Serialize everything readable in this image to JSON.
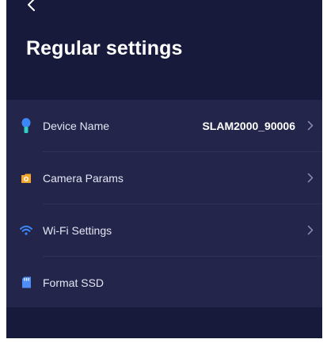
{
  "header": {
    "back_icon": "chevron-left-icon",
    "title": "Regular settings"
  },
  "settings": {
    "items": [
      {
        "icon": "pin-icon",
        "label": "Device Name",
        "value": "SLAM2000_90006",
        "has_chevron": true
      },
      {
        "icon": "folder-camera-icon",
        "label": "Camera Params",
        "value": "",
        "has_chevron": true
      },
      {
        "icon": "wifi-icon",
        "label": "Wi-Fi Settings",
        "value": "",
        "has_chevron": true
      },
      {
        "icon": "sd-card-icon",
        "label": "Format SSD",
        "value": "",
        "has_chevron": false
      }
    ]
  },
  "colors": {
    "background": "#171a3a",
    "list_background": "#23254a",
    "pin_blue": "#3d86f5",
    "pin_teal": "#2ed1c4",
    "folder_orange": "#f2a72a",
    "wifi_blue": "#3d86f5",
    "sd_blue": "#4f8ef7",
    "chevron": "#8e91b0"
  }
}
